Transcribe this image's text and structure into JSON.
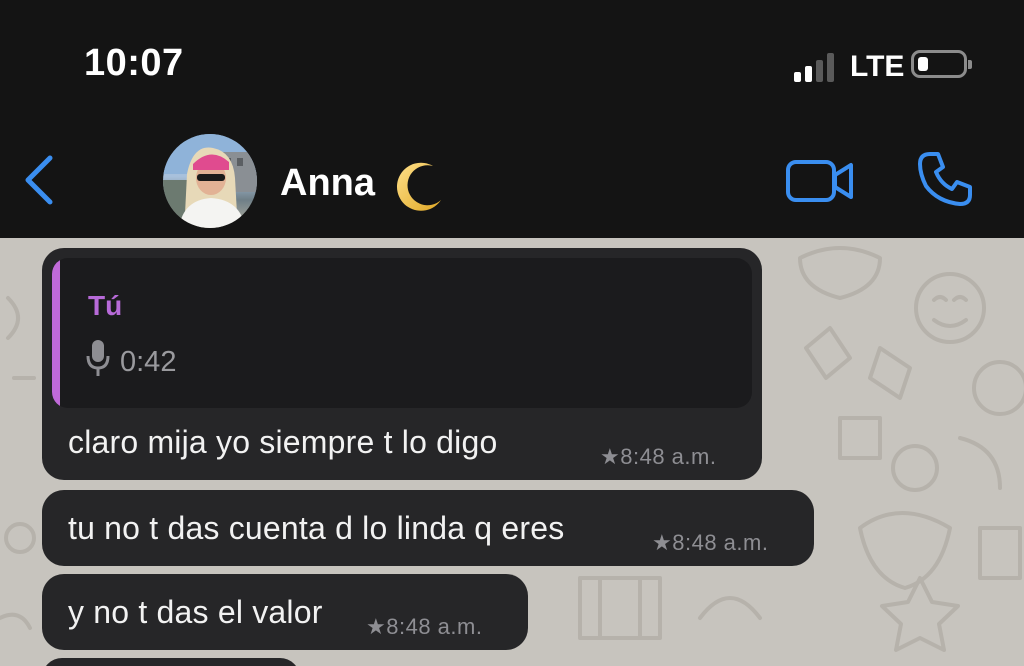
{
  "status_bar": {
    "time": "10:07",
    "network": "LTE",
    "signal_bars_filled": 2,
    "signal_bars_total": 4,
    "battery_level": 0.15
  },
  "header": {
    "back_icon": "chevron-left-icon",
    "contact_name": "Anna",
    "name_emoji_icon": "crescent-moon-icon",
    "video_call_icon": "video-camera-icon",
    "voice_call_icon": "phone-icon",
    "accent_color": "#3a8ef0"
  },
  "messages": [
    {
      "quoted": {
        "author": "Tú",
        "icon": "microphone-icon",
        "duration": "0:42"
      },
      "text": "claro mija yo siempre t lo digo",
      "time": "8:48 a.m.",
      "starred": true
    },
    {
      "text": "tu no t das cuenta d lo linda q eres",
      "time": "8:48 a.m.",
      "starred": true
    },
    {
      "text": "y no t das el valor",
      "time": "8:48 a.m.",
      "starred": true
    }
  ],
  "colors": {
    "bubble": "#262628",
    "chat_background": "#c7c4be",
    "quote_accent": "#c06ad9"
  }
}
